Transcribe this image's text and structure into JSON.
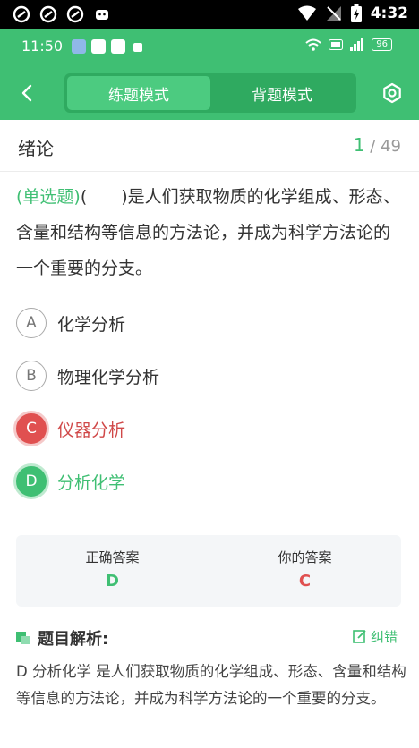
{
  "system_bar": {
    "time": "4:32"
  },
  "app_status": {
    "time": "11:50",
    "battery": "96"
  },
  "header": {
    "tabs": [
      {
        "label": "练题模式",
        "active": true
      },
      {
        "label": "背题模式",
        "active": false
      }
    ]
  },
  "chapter": {
    "title": "绪论",
    "current": "1",
    "total": "/ 49"
  },
  "question": {
    "type": "(单选题)",
    "stem": "(　　)是人们获取物质的化学组成、形态、含量和结构等信息的方法论，并成为科学方法论的一个重要的分支。"
  },
  "options": [
    {
      "letter": "A",
      "text": "化学分析",
      "state": "normal"
    },
    {
      "letter": "B",
      "text": "物理化学分析",
      "state": "normal"
    },
    {
      "letter": "C",
      "text": "仪器分析",
      "state": "wrong"
    },
    {
      "letter": "D",
      "text": "分析化学",
      "state": "right"
    }
  ],
  "answer": {
    "correct_label": "正确答案",
    "correct_value": "D",
    "yours_label": "你的答案",
    "yours_value": "C"
  },
  "analysis": {
    "title": "题目解析:",
    "correct_error_label": "纠错",
    "body": "D 分析化学 是人们获取物质的化学组成、形态、含量和结构等信息的方法论，并成为科学方法论的一个重要的分支。"
  },
  "colors": {
    "primary": "#3fbf73",
    "wrong": "#e05050"
  }
}
